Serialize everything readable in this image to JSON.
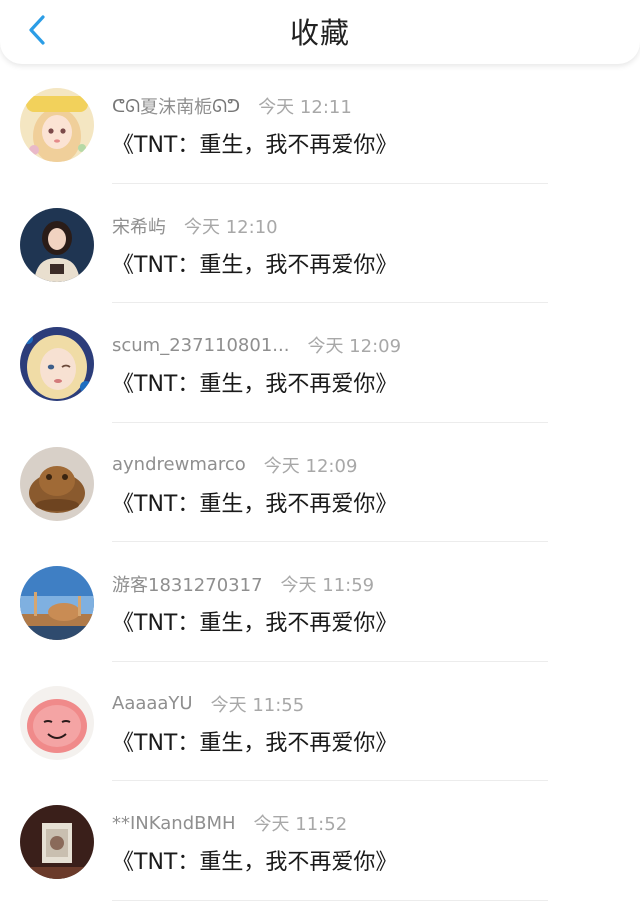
{
  "header": {
    "title": "收藏",
    "back_icon": "chevron-left-icon",
    "accent": "#2b9de6"
  },
  "items": [
    {
      "name": "夏沫南栀",
      "name_prefix": "ᕦᘏ",
      "name_suffix": "ᘏᕤ",
      "time": "今天 12:11",
      "content": "《TNT：重生，我不再爱你》"
    },
    {
      "name": "宋希屿",
      "time": "今天 12:10",
      "content": "《TNT：重生，我不再爱你》"
    },
    {
      "name": "scum_237110801...",
      "time": "今天 12:09",
      "content": "《TNT：重生，我不再爱你》"
    },
    {
      "name": "ayndrewmarco",
      "time": "今天 12:09",
      "content": "《TNT：重生，我不再爱你》"
    },
    {
      "name": "游客1831270317",
      "time": "今天 11:59",
      "content": "《TNT：重生，我不再爱你》"
    },
    {
      "name": "AaaaaYU",
      "time": "今天 11:55",
      "content": "《TNT：重生，我不再爱你》"
    },
    {
      "name": "**INKandBMH",
      "time": "今天 11:52",
      "content": "《TNT：重生，我不再爱你》"
    }
  ]
}
